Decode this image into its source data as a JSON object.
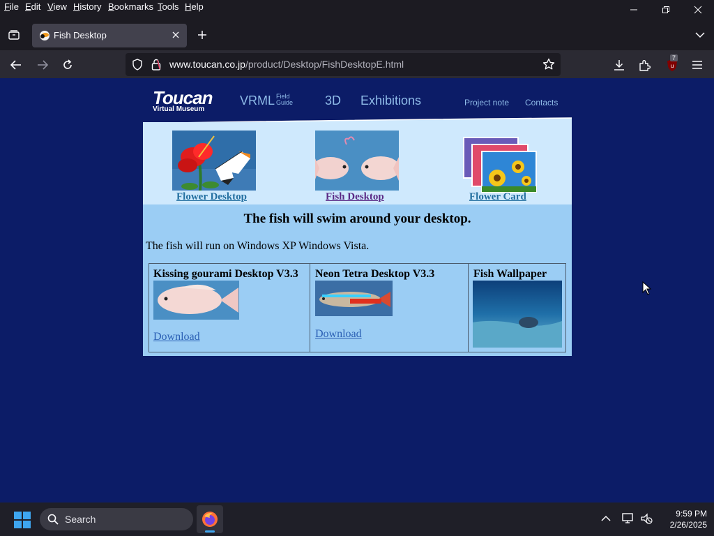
{
  "menubar": {
    "items": [
      {
        "label": "File",
        "accel": "F",
        "rest": "ile"
      },
      {
        "label": "Edit",
        "accel": "E",
        "rest": "dit"
      },
      {
        "label": "View",
        "accel": "V",
        "rest": "iew"
      },
      {
        "label": "History",
        "accel": "H",
        "rest": "istory"
      },
      {
        "label": "Bookmarks",
        "accel": "B",
        "rest": "ookmarks"
      },
      {
        "label": "Tools",
        "accel": "T",
        "rest": "ools"
      },
      {
        "label": "Help",
        "accel": "H",
        "rest": "elp"
      }
    ]
  },
  "tab": {
    "title": "Fish Desktop"
  },
  "urlbar": {
    "domain": "www.toucan.co.jp",
    "path": "/product/Desktop/FishDesktopE.html"
  },
  "extensions": {
    "badge_count": "7"
  },
  "site": {
    "logo": {
      "name": "Toucan",
      "sub": "Virtual Museum"
    },
    "nav": {
      "vrml": "VRML",
      "vrml_sup1": "Field",
      "vrml_sup2": "Guide",
      "d3": "3D",
      "exhibitions": "Exhibitions",
      "project_note": "Project note",
      "contacts": "Contacts"
    },
    "products": [
      {
        "title": "Flower Desktop",
        "color": "#236fa0"
      },
      {
        "title": "Fish Desktop",
        "color": "#5b2a86"
      },
      {
        "title": "Flower Card",
        "color": "#236fa0"
      }
    ],
    "headline": "The fish will swim around your desktop.",
    "requirements": "The fish will run on Windows XP Windows Vista.",
    "downloads": [
      {
        "title": "Kissing gourami Desktop V3.3",
        "link": "Download"
      },
      {
        "title": "Neon Tetra Desktop V3.3",
        "link": "Download"
      },
      {
        "title": "Fish Wallpaper"
      }
    ]
  },
  "taskbar": {
    "search_placeholder": "Search",
    "time": "9:59 PM",
    "date": "2/26/2025"
  },
  "colors": {
    "page_bg": "#0c1c67",
    "content_bg": "#9bcdf4",
    "strip_bg": "#cfe9fd",
    "nav_text": "#8fbbe8"
  }
}
